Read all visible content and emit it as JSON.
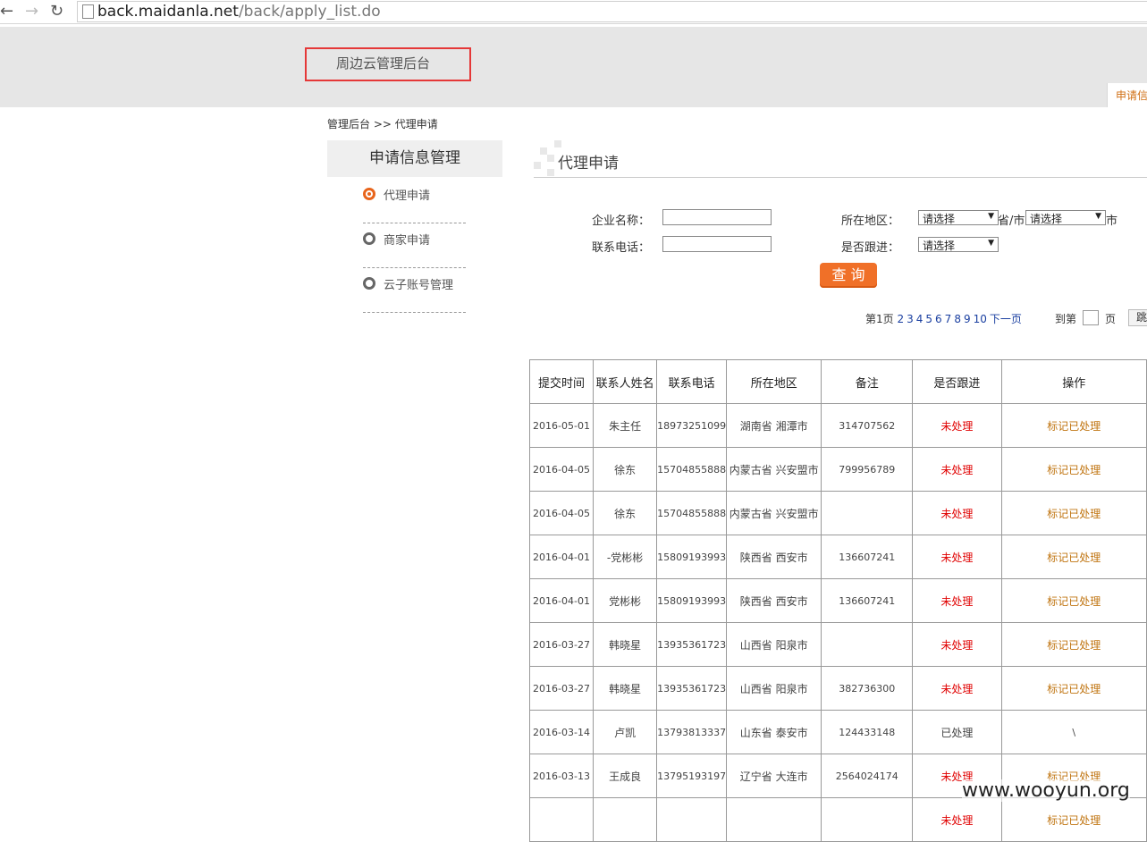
{
  "browser": {
    "back_icon": "←",
    "forward_icon": "→",
    "reload_icon": "↻",
    "url_host": "back.maidanla.net",
    "url_path": "/back/apply_list.do"
  },
  "header": {
    "logo_text": "周边云管理后台",
    "tab_label": "申请信"
  },
  "breadcrumb": "管理后台 >> 代理申请",
  "sidebar": {
    "title": "申请信息管理",
    "items": [
      {
        "label": "代理申请",
        "active": true
      },
      {
        "label": "商家申请",
        "active": false
      },
      {
        "label": "云子账号管理",
        "active": false
      }
    ]
  },
  "content": {
    "title": "代理申请"
  },
  "form": {
    "company_label": "企业名称：",
    "phone_label": "联系电话：",
    "region_label": "所在地区：",
    "province_select": "请选择",
    "province_suffix": "省/市",
    "city_select": "请选择",
    "city_suffix": "市",
    "follow_label": "是否跟进：",
    "follow_select": "请选择",
    "query_button": "查 询"
  },
  "pager": {
    "current": "第1页",
    "pages": [
      "2",
      "3",
      "4",
      "5",
      "6",
      "7",
      "8",
      "9",
      "10"
    ],
    "next": "下一页",
    "goto_prefix": "到第",
    "goto_suffix": "页",
    "go_button": "跳"
  },
  "table": {
    "headers": [
      "提交时间",
      "联系人姓名",
      "联系电话",
      "所在地区",
      "备注",
      "是否跟进",
      "操作"
    ],
    "rows": [
      {
        "date": "2016-05-01",
        "name": "朱主任",
        "phone": "18973251099",
        "region": "湖南省 湘潭市",
        "note": "314707562",
        "status": "未处理",
        "action": "标记已处理"
      },
      {
        "date": "2016-04-05",
        "name": "徐东",
        "phone": "15704855888",
        "region": "内蒙古省 兴安盟市",
        "note": "799956789",
        "status": "未处理",
        "action": "标记已处理"
      },
      {
        "date": "2016-04-05",
        "name": "徐东",
        "phone": "15704855888",
        "region": "内蒙古省 兴安盟市",
        "note": "",
        "status": "未处理",
        "action": "标记已处理"
      },
      {
        "date": "2016-04-01",
        "name": "-党彬彬",
        "phone": "15809193993",
        "region": "陕西省 西安市",
        "note": "136607241",
        "status": "未处理",
        "action": "标记已处理"
      },
      {
        "date": "2016-04-01",
        "name": "党彬彬",
        "phone": "15809193993",
        "region": "陕西省 西安市",
        "note": "136607241",
        "status": "未处理",
        "action": "标记已处理"
      },
      {
        "date": "2016-03-27",
        "name": "韩晓星",
        "phone": "13935361723",
        "region": "山西省 阳泉市",
        "note": "",
        "status": "未处理",
        "action": "标记已处理"
      },
      {
        "date": "2016-03-27",
        "name": "韩晓星",
        "phone": "13935361723",
        "region": "山西省 阳泉市",
        "note": "382736300",
        "status": "未处理",
        "action": "标记已处理"
      },
      {
        "date": "2016-03-14",
        "name": "卢凯",
        "phone": "13793813337",
        "region": "山东省 泰安市",
        "note": "124433148",
        "status": "已处理",
        "action": "\\"
      },
      {
        "date": "2016-03-13",
        "name": "王成良",
        "phone": "13795193197",
        "region": "辽宁省 大连市",
        "note": "2564024174",
        "status": "未处理",
        "action": "标记已处理"
      },
      {
        "date": "",
        "name": "",
        "phone": "",
        "region": "",
        "note": "",
        "status": "未处理",
        "action": "标记已处理"
      }
    ]
  },
  "watermark": "www.wooyun.org",
  "colors": {
    "accent_orange": "#f07028",
    "status_red": "#e00000",
    "action_brown": "#c07410",
    "logo_highlight_border": "#e53838"
  }
}
